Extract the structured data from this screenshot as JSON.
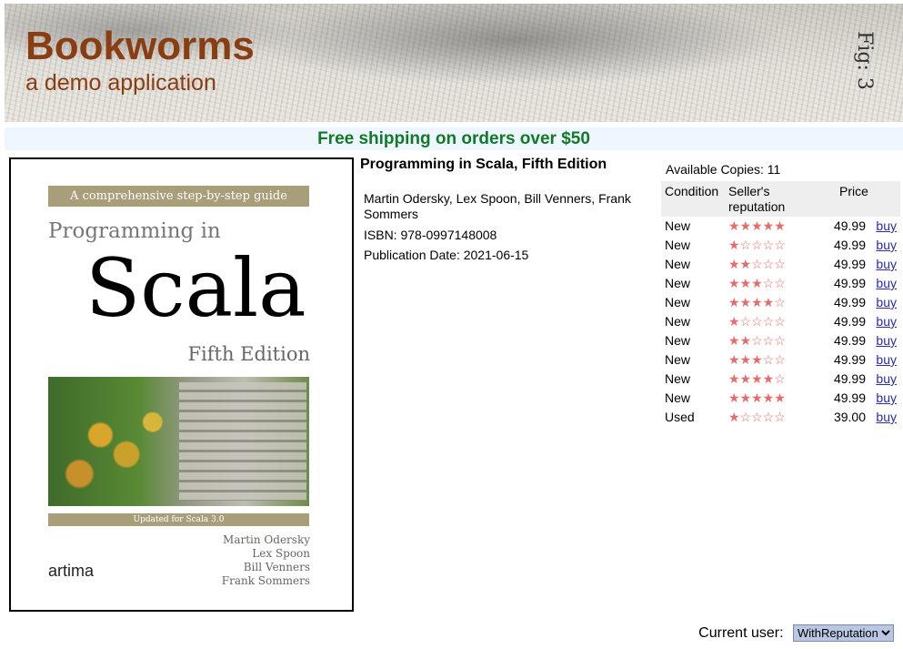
{
  "header": {
    "title": "Bookworms",
    "subtitle": "a demo application"
  },
  "banner": {
    "text": "Free shipping on orders over $50"
  },
  "book": {
    "title": "Programming in Scala, Fifth Edition",
    "authors": "Martin Odersky, Lex Spoon, Bill Venners, Frank Sommers",
    "isbn": "ISBN: 978-0997148008",
    "publication_date": "Publication Date: 2021-06-15"
  },
  "cover": {
    "top_band": "A comprehensive step-by-step guide",
    "line1": "Programming in",
    "line2": "Scala",
    "edition": "Fifth Edition",
    "bottom_band": "Updated for Scala 3.0",
    "authors": [
      "Martin Odersky",
      "Lex Spoon",
      "Bill Venners",
      "Frank Sommers"
    ],
    "publisher": "artima"
  },
  "offers": {
    "available": "Available Copies: 11",
    "headers": {
      "condition": "Condition",
      "reputation": "Seller's reputation",
      "price": "Price"
    },
    "rows": [
      {
        "condition": "New",
        "stars": "★★★★★",
        "rating": 5,
        "price": "49.99",
        "action": "buy"
      },
      {
        "condition": "New",
        "stars": "★☆☆☆☆",
        "rating": 1,
        "price": "49.99",
        "action": "buy"
      },
      {
        "condition": "New",
        "stars": "★★☆☆☆",
        "rating": 2,
        "price": "49.99",
        "action": "buy"
      },
      {
        "condition": "New",
        "stars": "★★★☆☆",
        "rating": 3,
        "price": "49.99",
        "action": "buy"
      },
      {
        "condition": "New",
        "stars": "★★★★☆",
        "rating": 4,
        "price": "49.99",
        "action": "buy"
      },
      {
        "condition": "New",
        "stars": "★☆☆☆☆",
        "rating": 1,
        "price": "49.99",
        "action": "buy"
      },
      {
        "condition": "New",
        "stars": "★★☆☆☆",
        "rating": 2,
        "price": "49.99",
        "action": "buy"
      },
      {
        "condition": "New",
        "stars": "★★★☆☆",
        "rating": 3,
        "price": "49.99",
        "action": "buy"
      },
      {
        "condition": "New",
        "stars": "★★★★☆",
        "rating": 4,
        "price": "49.99",
        "action": "buy"
      },
      {
        "condition": "New",
        "stars": "★★★★★",
        "rating": 5,
        "price": "49.99",
        "action": "buy"
      },
      {
        "condition": "Used",
        "stars": "★☆☆☆☆",
        "rating": 1,
        "price": "39.00",
        "action": "buy"
      }
    ]
  },
  "user": {
    "label": "Current user:",
    "selected": "WithReputation"
  },
  "colors": {
    "title": "#8b3d12",
    "banner_text": "#117a25",
    "banner_bg": "#eef6ff",
    "stars": "#e86a6a",
    "link": "#2a2ab7"
  }
}
